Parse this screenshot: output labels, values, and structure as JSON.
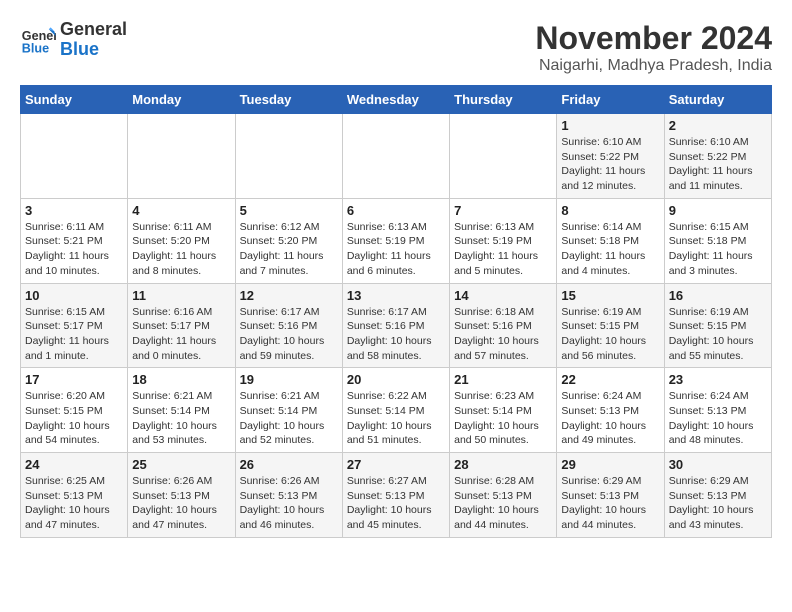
{
  "header": {
    "logo_line1": "General",
    "logo_line2": "Blue",
    "month": "November 2024",
    "location": "Naigarhi, Madhya Pradesh, India"
  },
  "weekdays": [
    "Sunday",
    "Monday",
    "Tuesday",
    "Wednesday",
    "Thursday",
    "Friday",
    "Saturday"
  ],
  "weeks": [
    [
      {
        "day": "",
        "detail": ""
      },
      {
        "day": "",
        "detail": ""
      },
      {
        "day": "",
        "detail": ""
      },
      {
        "day": "",
        "detail": ""
      },
      {
        "day": "",
        "detail": ""
      },
      {
        "day": "1",
        "detail": "Sunrise: 6:10 AM\nSunset: 5:22 PM\nDaylight: 11 hours\nand 12 minutes."
      },
      {
        "day": "2",
        "detail": "Sunrise: 6:10 AM\nSunset: 5:22 PM\nDaylight: 11 hours\nand 11 minutes."
      }
    ],
    [
      {
        "day": "3",
        "detail": "Sunrise: 6:11 AM\nSunset: 5:21 PM\nDaylight: 11 hours\nand 10 minutes."
      },
      {
        "day": "4",
        "detail": "Sunrise: 6:11 AM\nSunset: 5:20 PM\nDaylight: 11 hours\nand 8 minutes."
      },
      {
        "day": "5",
        "detail": "Sunrise: 6:12 AM\nSunset: 5:20 PM\nDaylight: 11 hours\nand 7 minutes."
      },
      {
        "day": "6",
        "detail": "Sunrise: 6:13 AM\nSunset: 5:19 PM\nDaylight: 11 hours\nand 6 minutes."
      },
      {
        "day": "7",
        "detail": "Sunrise: 6:13 AM\nSunset: 5:19 PM\nDaylight: 11 hours\nand 5 minutes."
      },
      {
        "day": "8",
        "detail": "Sunrise: 6:14 AM\nSunset: 5:18 PM\nDaylight: 11 hours\nand 4 minutes."
      },
      {
        "day": "9",
        "detail": "Sunrise: 6:15 AM\nSunset: 5:18 PM\nDaylight: 11 hours\nand 3 minutes."
      }
    ],
    [
      {
        "day": "10",
        "detail": "Sunrise: 6:15 AM\nSunset: 5:17 PM\nDaylight: 11 hours\nand 1 minute."
      },
      {
        "day": "11",
        "detail": "Sunrise: 6:16 AM\nSunset: 5:17 PM\nDaylight: 11 hours\nand 0 minutes."
      },
      {
        "day": "12",
        "detail": "Sunrise: 6:17 AM\nSunset: 5:16 PM\nDaylight: 10 hours\nand 59 minutes."
      },
      {
        "day": "13",
        "detail": "Sunrise: 6:17 AM\nSunset: 5:16 PM\nDaylight: 10 hours\nand 58 minutes."
      },
      {
        "day": "14",
        "detail": "Sunrise: 6:18 AM\nSunset: 5:16 PM\nDaylight: 10 hours\nand 57 minutes."
      },
      {
        "day": "15",
        "detail": "Sunrise: 6:19 AM\nSunset: 5:15 PM\nDaylight: 10 hours\nand 56 minutes."
      },
      {
        "day": "16",
        "detail": "Sunrise: 6:19 AM\nSunset: 5:15 PM\nDaylight: 10 hours\nand 55 minutes."
      }
    ],
    [
      {
        "day": "17",
        "detail": "Sunrise: 6:20 AM\nSunset: 5:15 PM\nDaylight: 10 hours\nand 54 minutes."
      },
      {
        "day": "18",
        "detail": "Sunrise: 6:21 AM\nSunset: 5:14 PM\nDaylight: 10 hours\nand 53 minutes."
      },
      {
        "day": "19",
        "detail": "Sunrise: 6:21 AM\nSunset: 5:14 PM\nDaylight: 10 hours\nand 52 minutes."
      },
      {
        "day": "20",
        "detail": "Sunrise: 6:22 AM\nSunset: 5:14 PM\nDaylight: 10 hours\nand 51 minutes."
      },
      {
        "day": "21",
        "detail": "Sunrise: 6:23 AM\nSunset: 5:14 PM\nDaylight: 10 hours\nand 50 minutes."
      },
      {
        "day": "22",
        "detail": "Sunrise: 6:24 AM\nSunset: 5:13 PM\nDaylight: 10 hours\nand 49 minutes."
      },
      {
        "day": "23",
        "detail": "Sunrise: 6:24 AM\nSunset: 5:13 PM\nDaylight: 10 hours\nand 48 minutes."
      }
    ],
    [
      {
        "day": "24",
        "detail": "Sunrise: 6:25 AM\nSunset: 5:13 PM\nDaylight: 10 hours\nand 47 minutes."
      },
      {
        "day": "25",
        "detail": "Sunrise: 6:26 AM\nSunset: 5:13 PM\nDaylight: 10 hours\nand 47 minutes."
      },
      {
        "day": "26",
        "detail": "Sunrise: 6:26 AM\nSunset: 5:13 PM\nDaylight: 10 hours\nand 46 minutes."
      },
      {
        "day": "27",
        "detail": "Sunrise: 6:27 AM\nSunset: 5:13 PM\nDaylight: 10 hours\nand 45 minutes."
      },
      {
        "day": "28",
        "detail": "Sunrise: 6:28 AM\nSunset: 5:13 PM\nDaylight: 10 hours\nand 44 minutes."
      },
      {
        "day": "29",
        "detail": "Sunrise: 6:29 AM\nSunset: 5:13 PM\nDaylight: 10 hours\nand 44 minutes."
      },
      {
        "day": "30",
        "detail": "Sunrise: 6:29 AM\nSunset: 5:13 PM\nDaylight: 10 hours\nand 43 minutes."
      }
    ]
  ]
}
